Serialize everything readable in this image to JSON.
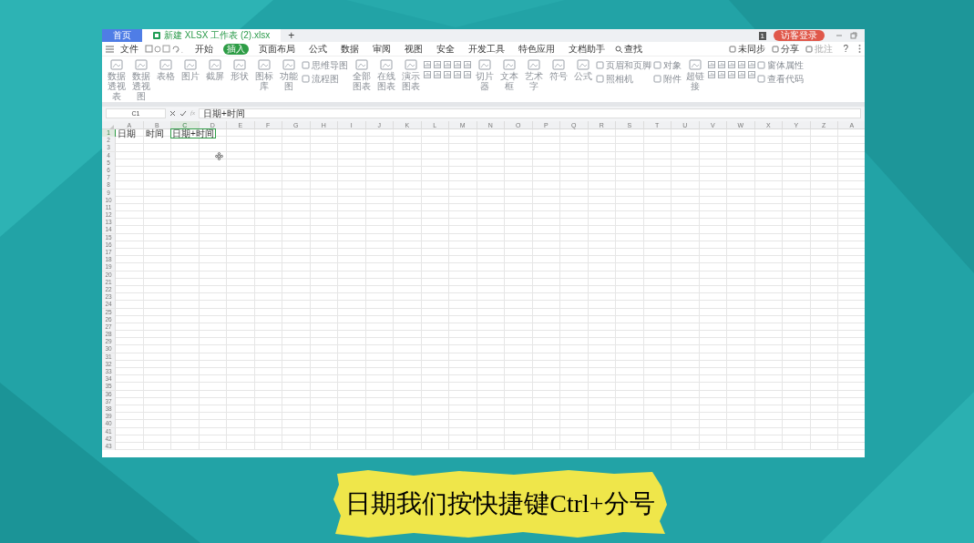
{
  "title_bar": {
    "tabs": [
      {
        "label": "首页",
        "selected": false
      },
      {
        "label": "新建 XLSX 工作表 (2).xlsx",
        "selected": true
      }
    ],
    "new_tab": "+",
    "badge": "1",
    "login": "访客登录"
  },
  "menu": {
    "file": "文件",
    "tabs": [
      {
        "label": "开始",
        "selected": false
      },
      {
        "label": "插入",
        "selected": true
      },
      {
        "label": "页面布局",
        "selected": false
      },
      {
        "label": "公式",
        "selected": false
      },
      {
        "label": "数据",
        "selected": false
      },
      {
        "label": "审阅",
        "selected": false
      },
      {
        "label": "视图",
        "selected": false
      },
      {
        "label": "安全",
        "selected": false
      },
      {
        "label": "开发工具",
        "selected": false
      },
      {
        "label": "特色应用",
        "selected": false
      },
      {
        "label": "文档助手",
        "selected": false
      }
    ],
    "search": "查找",
    "right": [
      "未同步",
      "分享",
      "批注"
    ],
    "help": "?"
  },
  "ribbon": [
    {
      "kind": "large",
      "label": "数据透视表"
    },
    {
      "kind": "large",
      "label": "数据透视图"
    },
    {
      "kind": "large",
      "label": "表格"
    },
    {
      "kind": "large",
      "label": "图片"
    },
    {
      "kind": "large",
      "label": "截屏"
    },
    {
      "kind": "large",
      "label": "形状"
    },
    {
      "kind": "large",
      "label": "图标库"
    },
    {
      "kind": "large",
      "label": "功能图"
    },
    {
      "kind": "pair",
      "labels": [
        "思维导图",
        "流程图"
      ]
    },
    {
      "kind": "large",
      "label": "全部图表"
    },
    {
      "kind": "large",
      "label": "在线图表"
    },
    {
      "kind": "large",
      "label": "演示图表"
    },
    {
      "kind": "icons"
    },
    {
      "kind": "large",
      "label": "切片器"
    },
    {
      "kind": "large",
      "label": "文本框"
    },
    {
      "kind": "large",
      "label": "艺术字"
    },
    {
      "kind": "large",
      "label": "符号"
    },
    {
      "kind": "large",
      "label": "公式"
    },
    {
      "kind": "pair",
      "labels": [
        "页眉和页脚",
        "照相机"
      ]
    },
    {
      "kind": "pair",
      "labels": [
        "对象",
        "附件"
      ]
    },
    {
      "kind": "large",
      "label": "超链接"
    },
    {
      "kind": "icons"
    },
    {
      "kind": "pair",
      "labels": [
        "窗体属性",
        "查看代码"
      ]
    }
  ],
  "formula_bar": {
    "name_box": "C1",
    "fx": "fx",
    "formula": "日期+时间"
  },
  "sheet": {
    "columns": [
      {
        "label": "A",
        "selected": false
      },
      {
        "label": "B",
        "selected": false
      },
      {
        "label": "C",
        "selected": true
      },
      {
        "label": "D",
        "selected": false
      },
      {
        "label": "E",
        "selected": false
      },
      {
        "label": "F",
        "selected": false
      },
      {
        "label": "G",
        "selected": false
      },
      {
        "label": "H",
        "selected": false
      },
      {
        "label": "I",
        "selected": false
      },
      {
        "label": "J",
        "selected": false
      },
      {
        "label": "K",
        "selected": false
      },
      {
        "label": "L",
        "selected": false
      },
      {
        "label": "M",
        "selected": false
      },
      {
        "label": "N",
        "selected": false
      },
      {
        "label": "O",
        "selected": false
      },
      {
        "label": "P",
        "selected": false
      },
      {
        "label": "Q",
        "selected": false
      },
      {
        "label": "R",
        "selected": false
      },
      {
        "label": "S",
        "selected": false
      },
      {
        "label": "T",
        "selected": false
      },
      {
        "label": "U",
        "selected": false
      },
      {
        "label": "V",
        "selected": false
      },
      {
        "label": "W",
        "selected": false
      },
      {
        "label": "X",
        "selected": false
      },
      {
        "label": "Y",
        "selected": false
      },
      {
        "label": "Z",
        "selected": false
      },
      {
        "label": "A",
        "selected": false
      }
    ],
    "rows": [
      {
        "header": "1",
        "selected": true,
        "cells": [
          {
            "text": "日期",
            "selected": false
          },
          {
            "text": "时间",
            "selected": false
          },
          {
            "text": "日期+时间",
            "selected": true
          }
        ]
      },
      {
        "header": "2"
      },
      {
        "header": "3"
      },
      {
        "header": "4"
      },
      {
        "header": "5"
      },
      {
        "header": "6"
      },
      {
        "header": "7"
      },
      {
        "header": "8"
      },
      {
        "header": "9"
      },
      {
        "header": "10"
      },
      {
        "header": "11"
      },
      {
        "header": "12"
      },
      {
        "header": "13"
      },
      {
        "header": "14"
      },
      {
        "header": "15"
      },
      {
        "header": "16"
      },
      {
        "header": "17"
      },
      {
        "header": "18"
      },
      {
        "header": "19"
      },
      {
        "header": "20"
      },
      {
        "header": "21"
      },
      {
        "header": "22"
      },
      {
        "header": "23"
      },
      {
        "header": "24"
      },
      {
        "header": "25"
      },
      {
        "header": "26"
      },
      {
        "header": "27"
      },
      {
        "header": "28"
      },
      {
        "header": "29"
      },
      {
        "header": "30"
      },
      {
        "header": "31"
      },
      {
        "header": "32"
      },
      {
        "header": "33"
      },
      {
        "header": "34"
      },
      {
        "header": "35"
      },
      {
        "header": "36"
      },
      {
        "header": "37"
      },
      {
        "header": "38"
      },
      {
        "header": "39"
      },
      {
        "header": "40"
      },
      {
        "header": "41"
      },
      {
        "header": "42"
      },
      {
        "header": "43"
      }
    ]
  },
  "subtitle": "日期我们按快捷键Ctrl+分号"
}
